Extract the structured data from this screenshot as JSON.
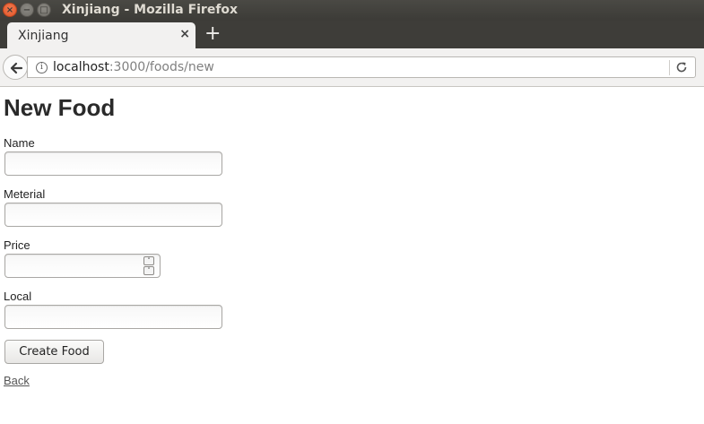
{
  "window": {
    "title": "Xinjiang - Mozilla Firefox",
    "close_glyph": "×",
    "minimize_glyph": "−",
    "maximize_glyph": "□"
  },
  "tabs": [
    {
      "label": "Xinjiang",
      "close_glyph": "×",
      "active": true
    }
  ],
  "new_tab_glyph": "+",
  "navbar": {
    "url_host": "localhost",
    "url_path": ":3000/foods/new",
    "info_glyph": "i"
  },
  "page": {
    "heading": "New Food",
    "fields": [
      {
        "label": "Name",
        "value": "",
        "type": "text"
      },
      {
        "label": "Meterial",
        "value": "",
        "type": "text"
      },
      {
        "label": "Price",
        "value": "",
        "type": "number"
      },
      {
        "label": "Local",
        "value": "",
        "type": "text"
      }
    ],
    "spin_up": "˄",
    "spin_down": "˅",
    "submit_label": "Create Food",
    "back_link": "Back"
  },
  "colors": {
    "titlebar": "#3c3b37",
    "close_button": "#e0562a",
    "tab_active": "#f2f1f0"
  }
}
